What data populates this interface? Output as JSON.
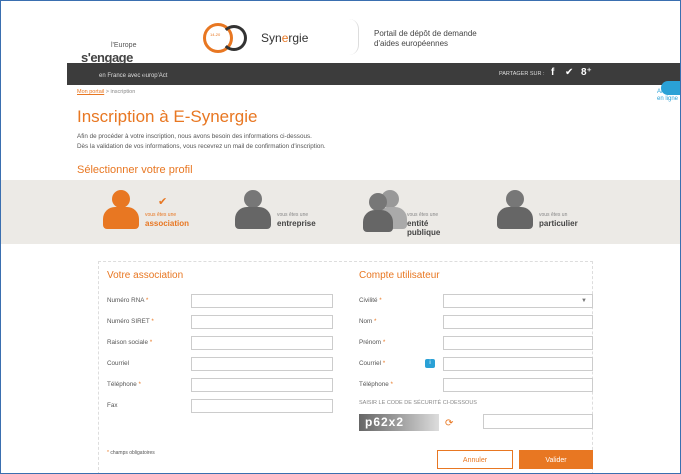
{
  "header": {
    "europe_small": "l'Europe",
    "europe_sub": "s'",
    "engage": "engage",
    "synergie_prefix": "Syn",
    "synergie_accent": "e",
    "synergie_suffix": "rgie",
    "synergie_badge": "14-20",
    "portal_desc_line1": "Portail de dépôt de demande",
    "portal_desc_line2": "d'aides européennes"
  },
  "darkbar": {
    "france_text": "en France avec ℮urop'Act",
    "share_label": "PARTAGER SUR :",
    "facebook": "f",
    "twitter": "✔",
    "gplus": "8⁺"
  },
  "breadcrumb": {
    "home": "Mon portail",
    "sep": ">",
    "current": "inscription"
  },
  "page_title": "Inscription à E-Synergie",
  "intro": {
    "line1": "Afin de procéder à votre inscription, nous avons besoin des informations ci-dessous.",
    "line2": "Dès la validation de vos informations, vous recevrez un mail de confirmation d'inscription."
  },
  "profile_section_title": "Sélectionner votre profil",
  "profiles": [
    {
      "small": "vous êtes une",
      "name": "association",
      "active": true
    },
    {
      "small": "vous êtes une",
      "name": "entreprise",
      "active": false
    },
    {
      "small": "vous êtes une",
      "name": "entité",
      "name2": "publique",
      "active": false
    },
    {
      "small": "vous êtes un",
      "name": "particulier",
      "active": false
    }
  ],
  "colors": {
    "accent": "#e87722",
    "dark": "#3c3c3c",
    "info": "#2aa1d6"
  },
  "left_form": {
    "title": "Votre association",
    "fields": [
      {
        "label": "Numéro RNA",
        "required": "*"
      },
      {
        "label": "Numéro SIRET",
        "required": "*"
      },
      {
        "label": "Raison sociale",
        "required": "*"
      },
      {
        "label": "Courriel",
        "required": ""
      },
      {
        "label": "Téléphone",
        "required": "*"
      },
      {
        "label": "Fax",
        "required": ""
      }
    ]
  },
  "right_form": {
    "title": "Compte utilisateur",
    "fields": [
      {
        "label": "Civilité",
        "required": "*"
      },
      {
        "label": "Nom",
        "required": "*"
      },
      {
        "label": "Prénom",
        "required": "*"
      },
      {
        "label": "Courriel",
        "required": "*"
      },
      {
        "label": "Téléphone",
        "required": "*"
      }
    ],
    "captcha_label": "SAISIR LE CODE DE SÉCURITÉ CI-DESSOUS",
    "captcha_text": "p62x2"
  },
  "required_note_star": "*",
  "required_note": "champs obligatoires",
  "buttons": {
    "cancel": "Annuler",
    "submit": "Valider"
  },
  "aide": {
    "line1": "Aide",
    "line2": "en ligne"
  },
  "info_icon": "i",
  "refresh_icon": "⟳",
  "select_arrow": "▼",
  "check": "✔"
}
